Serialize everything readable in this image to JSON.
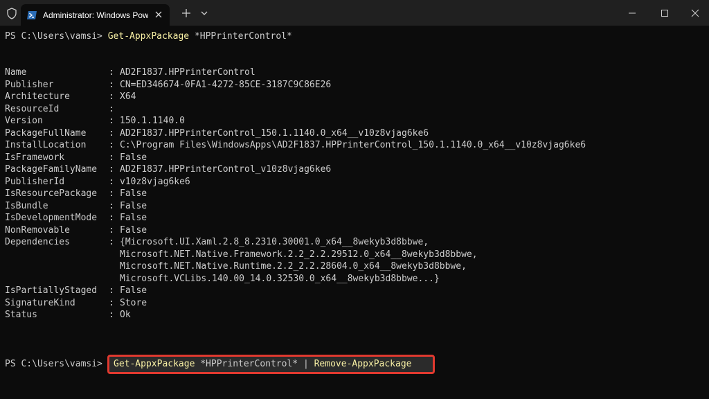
{
  "window": {
    "tab_title": "Administrator: Windows PowerShell",
    "icons": [
      "shield-icon",
      "powershell-icon",
      "close-icon",
      "plus-icon",
      "chevron-down-icon",
      "minimize-icon",
      "maximize-icon",
      "window-close-icon"
    ]
  },
  "terminal": {
    "prompt": "PS C:\\Users\\vamsi>",
    "first_command": "Get-AppxPackage",
    "first_command_arg": "*HPPrinterControl*",
    "properties": [
      {
        "name": "Name",
        "value": "AD2F1837.HPPrinterControl"
      },
      {
        "name": "Publisher",
        "value": "CN=ED346674-0FA1-4272-85CE-3187C9C86E26"
      },
      {
        "name": "Architecture",
        "value": "X64"
      },
      {
        "name": "ResourceId",
        "value": ""
      },
      {
        "name": "Version",
        "value": "150.1.1140.0"
      },
      {
        "name": "PackageFullName",
        "value": "AD2F1837.HPPrinterControl_150.1.1140.0_x64__v10z8vjag6ke6"
      },
      {
        "name": "InstallLocation",
        "value": "C:\\Program Files\\WindowsApps\\AD2F1837.HPPrinterControl_150.1.1140.0_x64__v10z8vjag6ke6"
      },
      {
        "name": "IsFramework",
        "value": "False"
      },
      {
        "name": "PackageFamilyName",
        "value": "AD2F1837.HPPrinterControl_v10z8vjag6ke6"
      },
      {
        "name": "PublisherId",
        "value": "v10z8vjag6ke6"
      },
      {
        "name": "IsResourcePackage",
        "value": "False"
      },
      {
        "name": "IsBundle",
        "value": "False"
      },
      {
        "name": "IsDevelopmentMode",
        "value": "False"
      },
      {
        "name": "NonRemovable",
        "value": "False"
      },
      {
        "name": "Dependencies",
        "value": "{Microsoft.UI.Xaml.2.8_8.2310.30001.0_x64__8wekyb3d8bbwe,"
      },
      {
        "name": "",
        "value": "Microsoft.NET.Native.Framework.2.2_2.2.29512.0_x64__8wekyb3d8bbwe,"
      },
      {
        "name": "",
        "value": "Microsoft.NET.Native.Runtime.2.2_2.2.28604.0_x64__8wekyb3d8bbwe,"
      },
      {
        "name": "",
        "value": "Microsoft.VCLibs.140.00_14.0.32530.0_x64__8wekyb3d8bbwe...}"
      },
      {
        "name": "IsPartiallyStaged",
        "value": "False"
      },
      {
        "name": "SignatureKind",
        "value": "Store"
      },
      {
        "name": "Status",
        "value": "Ok"
      }
    ],
    "second_command": "Get-AppxPackage",
    "second_command_arg": "*HPPrinterControl*",
    "second_command_pipe": "|",
    "second_command_pipe_target": "Remove-AppxPackage"
  },
  "colors": {
    "background": "#0c0c0c",
    "titlebar": "#202020",
    "text": "#cccccc",
    "command": "#f9f1a5",
    "highlight_border": "#e0392f"
  }
}
